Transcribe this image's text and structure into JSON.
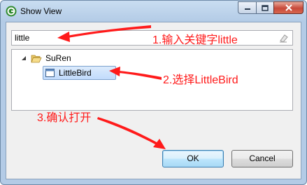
{
  "window": {
    "title": "Show View",
    "controls": {
      "minimize": "minimize",
      "maximize": "maximize",
      "close": "close"
    }
  },
  "filter": {
    "value": "little",
    "clear_icon": "eraser-icon"
  },
  "tree": {
    "root": {
      "label": "SuRen",
      "icon": "folder-open-icon",
      "expanded": true
    },
    "child": {
      "label": "LittleBird",
      "icon": "view-icon",
      "selected": true
    }
  },
  "buttons": {
    "ok": "OK",
    "cancel": "Cancel"
  },
  "annotations": {
    "step1": "1.输入关键字little",
    "step2": "2.选择LittleBird",
    "step3": "3.确认打开",
    "color": "#ff1a1a"
  },
  "colors": {
    "title_bar": "#c9ddf1",
    "client_bg": "#f0f0f0",
    "selection": "#c1dbfc",
    "close_button": "#c7493a"
  }
}
